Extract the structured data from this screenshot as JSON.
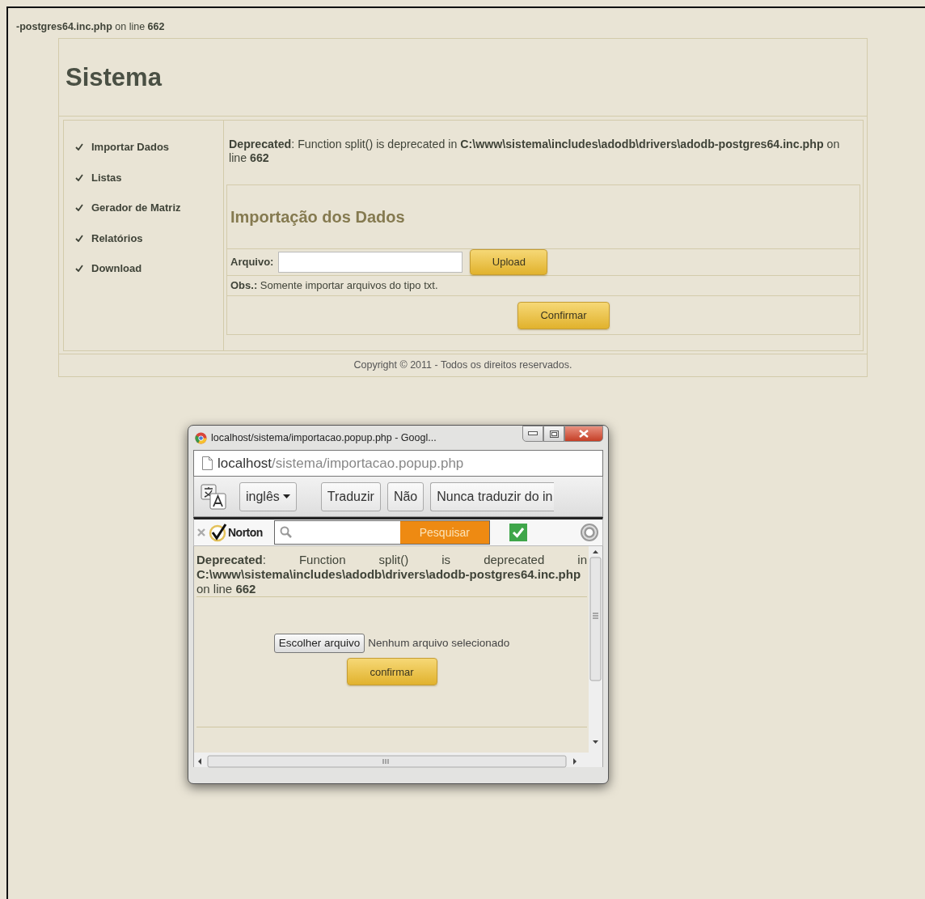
{
  "error_line": "**-postgres64.inc.php** on line **662**",
  "header": {
    "title": "Sistema"
  },
  "menu": [
    {
      "label": "Importar Dados"
    },
    {
      "label": "Listas"
    },
    {
      "label": "Gerador de Matriz"
    },
    {
      "label": "Relatórios"
    },
    {
      "label": "Download"
    }
  ],
  "notice": "**Deprecated**: Function split() is deprecated in **C:\\www\\sistema\\includes\\adodb\\drivers\\adodb-postgres64.inc.php** on line **662**",
  "import_panel": {
    "title": "Importação dos Dados",
    "file_label": "Arquivo:",
    "upload_button": "Upload",
    "note": "**Obs.:** Somente importar arquivos do tipo txt.",
    "confirm_button": "Confirmar"
  },
  "footer": "Copyright © 2011 - Todos os direitos reservados.",
  "popup": {
    "title": "localhost/sistema/importacao.popup.php - Googl...",
    "address": {
      "host": "localhost",
      "path": "/sistema/importacao.popup.php"
    },
    "translate_bar": {
      "language": "inglês",
      "translate_button": "Traduzir",
      "no_button": "Não",
      "never_button": "Nunca traduzir do in"
    },
    "norton": {
      "brand": "Norton",
      "search_button": "Pesquisar"
    },
    "notice": "**Deprecated**: Function split() is deprecated in **C:\\www\\sistema\\includes\\adodb\\drivers\\adodb-postgres64.inc.php** on line **662**",
    "file_chooser": {
      "button": "Escolher arquivo",
      "status": "Nenhum arquivo selecionado"
    },
    "confirm_button": "confirmar"
  }
}
